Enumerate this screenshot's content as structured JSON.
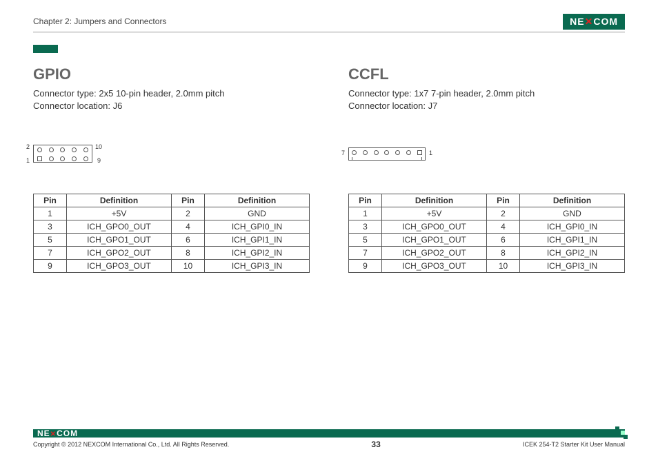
{
  "header": {
    "chapter": "Chapter 2: Jumpers and Connectors",
    "logo_text": "NEXCOM"
  },
  "sections": [
    {
      "title": "GPIO",
      "connector_type": "Connector type: 2x5 10-pin header, 2.0mm pitch",
      "connector_location": "Connector location: J6",
      "diagram": {
        "type": "2x5",
        "labels": {
          "tl": "2",
          "tr": "10",
          "bl": "1",
          "br": "9"
        }
      },
      "table": {
        "headers": [
          "Pin",
          "Definition",
          "Pin",
          "Definition"
        ],
        "rows": [
          [
            "1",
            "+5V",
            "2",
            "GND"
          ],
          [
            "3",
            "ICH_GPO0_OUT",
            "4",
            "ICH_GPI0_IN"
          ],
          [
            "5",
            "ICH_GPO1_OUT",
            "6",
            "ICH_GPI1_IN"
          ],
          [
            "7",
            "ICH_GPO2_OUT",
            "8",
            "ICH_GPI2_IN"
          ],
          [
            "9",
            "ICH_GPO3_OUT",
            "10",
            "ICH_GPI3_IN"
          ]
        ]
      }
    },
    {
      "title": "CCFL",
      "connector_type": "Connector type: 1x7 7-pin header, 2.0mm pitch",
      "connector_location": "Connector location: J7",
      "diagram": {
        "type": "1x7",
        "labels": {
          "left": "7",
          "right": "1"
        }
      },
      "table": {
        "headers": [
          "Pin",
          "Definition",
          "Pin",
          "Definition"
        ],
        "rows": [
          [
            "1",
            "+5V",
            "2",
            "GND"
          ],
          [
            "3",
            "ICH_GPO0_OUT",
            "4",
            "ICH_GPI0_IN"
          ],
          [
            "5",
            "ICH_GPO1_OUT",
            "6",
            "ICH_GPI1_IN"
          ],
          [
            "7",
            "ICH_GPO2_OUT",
            "8",
            "ICH_GPI2_IN"
          ],
          [
            "9",
            "ICH_GPO3_OUT",
            "10",
            "ICH_GPI3_IN"
          ]
        ]
      }
    }
  ],
  "footer": {
    "logo_text": "NEXCOM",
    "copyright": "Copyright © 2012 NEXCOM International Co., Ltd. All Rights Reserved.",
    "page_number": "33",
    "manual_name": "ICEK 254-T2 Starter Kit User Manual"
  }
}
